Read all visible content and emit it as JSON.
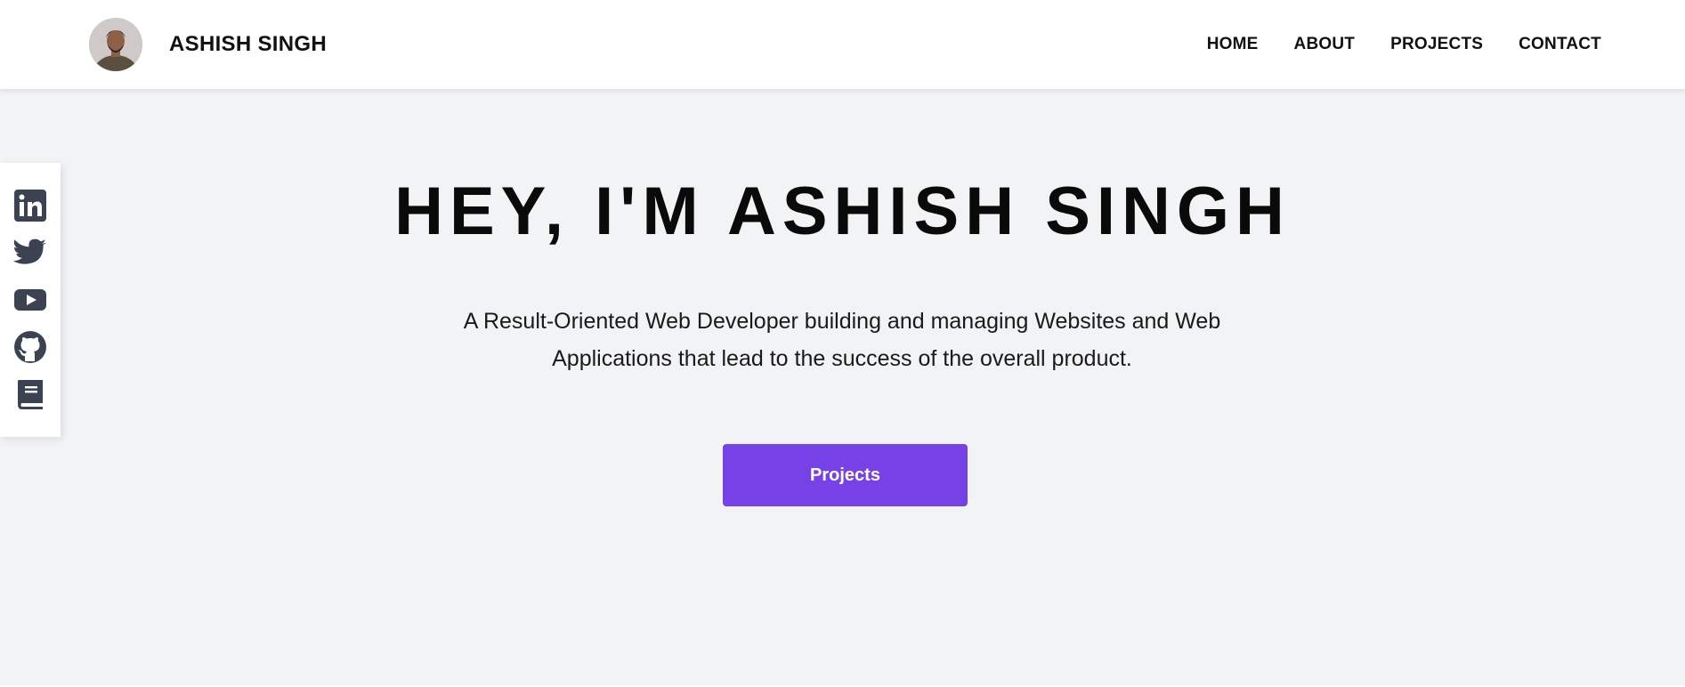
{
  "header": {
    "brand_name": "ASHISH SINGH",
    "avatar_icon": "profile-photo",
    "nav": [
      {
        "label": "HOME"
      },
      {
        "label": "ABOUT"
      },
      {
        "label": "PROJECTS"
      },
      {
        "label": "CONTACT"
      }
    ]
  },
  "social": [
    {
      "icon": "linkedin-icon"
    },
    {
      "icon": "twitter-icon"
    },
    {
      "icon": "youtube-icon"
    },
    {
      "icon": "github-icon"
    },
    {
      "icon": "book-icon"
    }
  ],
  "hero": {
    "title": "HEY, I'M ASHISH SINGH",
    "subtitle_line1": "A Result-Oriented Web Developer building and managing Websites and Web",
    "subtitle_line2": "Applications that lead to the success of the overall product.",
    "cta_label": "Projects"
  },
  "colors": {
    "accent": "#7741e8",
    "background": "#f2f3f5",
    "header_bg": "#ffffff",
    "icon": "#3b4252"
  }
}
